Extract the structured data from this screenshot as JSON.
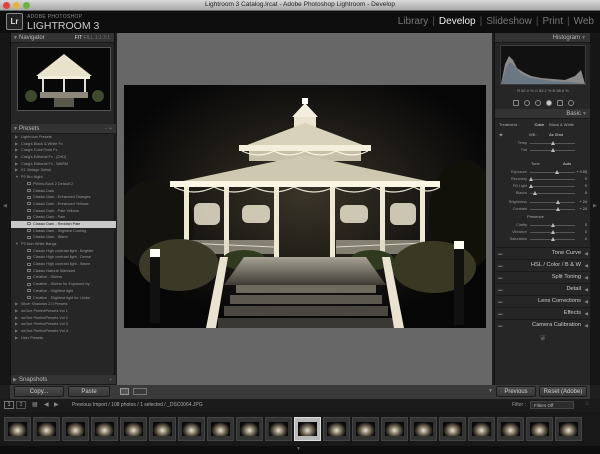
{
  "window": {
    "title": "Lightroom 3 Catalog.lrcat - Adobe Photoshop Lightroom - Develop"
  },
  "identity": {
    "logo": "Lr",
    "vendor": "ADOBE PHOTOSHOP",
    "product": "LIGHTROOM 3"
  },
  "modules": [
    "Library",
    "Develop",
    "Slideshow",
    "Print",
    "Web"
  ],
  "active_module": "Develop",
  "navigator": {
    "title": "Navigator",
    "zoom_options": [
      "FIT",
      "FILL",
      "1:1",
      "3:1"
    ]
  },
  "presets": {
    "title": "Presets",
    "items": [
      {
        "label": "Lightroom Presets",
        "level": 0,
        "folder": true
      },
      {
        "label": "Craig's Black & White Fx",
        "level": 0,
        "folder": true
      },
      {
        "label": "Craig's Color/Tone Fx",
        "level": 0,
        "folder": true
      },
      {
        "label": "Craig's Editorial Fx - (2HD)",
        "level": 0,
        "folder": true
      },
      {
        "label": "Craig's Editorial Fx - WARM",
        "level": 0,
        "folder": true
      },
      {
        "label": "K1 Vintage Delish",
        "level": 0,
        "folder": true
      },
      {
        "label": "P3 Bro Night",
        "level": 0,
        "folder": true,
        "open": true
      },
      {
        "label": "PWiris-Buck 2 Default 2",
        "level": 1
      },
      {
        "label": "Classic Dark",
        "level": 1
      },
      {
        "label": "Classic Dark - Enhanced Oranges",
        "level": 1
      },
      {
        "label": "Classic Dark - Enhanced Yellows",
        "level": 1
      },
      {
        "label": "Classic Dark - Pale Yellows",
        "level": 1
      },
      {
        "label": "Classic Dark - Pale",
        "level": 1
      },
      {
        "label": "Classic Dark - Reddish Pale",
        "level": 1,
        "selected": true
      },
      {
        "label": "Classic Dark - Slightest Cooling",
        "level": 1
      },
      {
        "label": "Classic Dark - Warm",
        "level": 1
      },
      {
        "label": "P3 Non-White Bangs",
        "level": 0,
        "folder": true,
        "open": true
      },
      {
        "label": "Classic High contrast light - Brighter",
        "level": 1
      },
      {
        "label": "Classic High contrast light - Dense",
        "level": 1
      },
      {
        "label": "Classic High contrast light - Warm",
        "level": 1
      },
      {
        "label": "Classic Natural Standard",
        "level": 1
      },
      {
        "label": "Creative - Silvers",
        "level": 1
      },
      {
        "label": "Creative - Silvers for Exposure by",
        "level": 1
      },
      {
        "label": "Creative - Slightest light",
        "level": 1
      },
      {
        "label": "Creative - Slightest light for Limbs",
        "level": 1
      },
      {
        "label": "Silver Shadows 2.0 Presets",
        "level": 0,
        "folder": true
      },
      {
        "label": "onOne PerfectPresets Vol 1",
        "level": 0,
        "folder": true
      },
      {
        "label": "onOne PerfectPresets Vol 2",
        "level": 0,
        "folder": true
      },
      {
        "label": "onOne PerfectPresets Vol 3",
        "level": 0,
        "folder": true
      },
      {
        "label": "onOne PerfectPresets Vol 4",
        "level": 0,
        "folder": true
      },
      {
        "label": "User Presets",
        "level": 0,
        "folder": true
      }
    ]
  },
  "snapshots": {
    "title": "Snapshots"
  },
  "left_buttons": {
    "copy": "Copy...",
    "paste": "Paste"
  },
  "histogram": {
    "title": "Histogram",
    "readout": "R  82.9  %   G  85.2  %   B  58.6  %"
  },
  "basic": {
    "title": "Basic",
    "treatment_label": "Treatment :",
    "treatment_options": [
      "Color",
      "Black & White"
    ],
    "wb_label": "WB :",
    "wb_value": "As Shot",
    "tone_label": "Tone",
    "tone_auto": "Auto",
    "presence_label": "Presence",
    "sliders": [
      {
        "name": "Temp",
        "value": "",
        "pos": 0.5
      },
      {
        "name": "Tint",
        "value": "",
        "pos": 0.5
      },
      {
        "name": "Exposure",
        "value": "+ 0.55",
        "pos": 0.6
      },
      {
        "name": "Recovery",
        "value": "0",
        "pos": 0.02
      },
      {
        "name": "Fill Light",
        "value": "0",
        "pos": 0.02
      },
      {
        "name": "Blacks",
        "value": "5",
        "pos": 0.1
      },
      {
        "name": "Brightness",
        "value": "+ 24",
        "pos": 0.62
      },
      {
        "name": "Contrast",
        "value": "+ 24",
        "pos": 0.62
      },
      {
        "name": "Clarity",
        "value": "0",
        "pos": 0.5
      },
      {
        "name": "Vibrance",
        "value": "0",
        "pos": 0.5
      },
      {
        "name": "Saturation",
        "value": "0",
        "pos": 0.5
      }
    ]
  },
  "right_sections": [
    "Tone Curve",
    "HSL / Color / B & W",
    "Split Toning",
    "Detail",
    "Lens Corrections",
    "Effects",
    "Camera Calibration"
  ],
  "right_buttons": {
    "previous": "Previous",
    "reset": "Reset (Adobe)"
  },
  "filmstrip": {
    "pages": [
      "1",
      "2"
    ],
    "status": "Previous Import / 108 photos / 1 selected / _DSC0064.JPG",
    "filter_label": "Filter :",
    "filter_value": "Filters Off",
    "thumb_count": 20,
    "selected_index": 10
  },
  "colors": {
    "accent": "#eeeeee",
    "panel": "#262626",
    "center": "#676767"
  }
}
